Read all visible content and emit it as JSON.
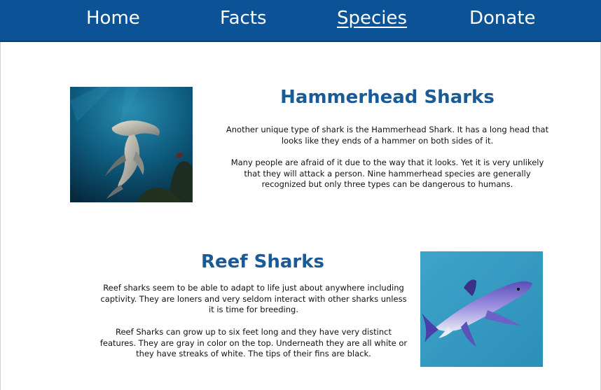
{
  "nav": {
    "items": [
      {
        "label": "Home"
      },
      {
        "label": "Facts"
      },
      {
        "label": "Species"
      },
      {
        "label": "Donate"
      }
    ],
    "active": "Species"
  },
  "sections": [
    {
      "title": "Hammerhead Sharks",
      "image": "hammerhead-shark-photo",
      "paragraphs": [
        "Another unique type of shark is the Hammerhead Shark. It has a long head that looks like they ends of a hammer on both sides of it.",
        "Many people are afraid of it due to the way that it looks. Yet it is very unlikely that they will attack a person. Nine hammerhead species are generally recognized but only three types can be dangerous to humans."
      ]
    },
    {
      "title": "Reef Sharks",
      "image": "reef-shark-photo",
      "paragraphs": [
        "Reef sharks seem to be able to adapt to life just about anywhere including captivity. They are loners and very seldom interact with other sharks unless it is time for breeding.",
        "Reef Sharks can grow up to six feet long and they have very distinct features. They are gray in color on the top. Underneath they are all white or they have streaks of white. The tips of their fins are black."
      ]
    }
  ],
  "colors": {
    "nav_background": "#0b5296",
    "heading": "#1a5a96"
  }
}
